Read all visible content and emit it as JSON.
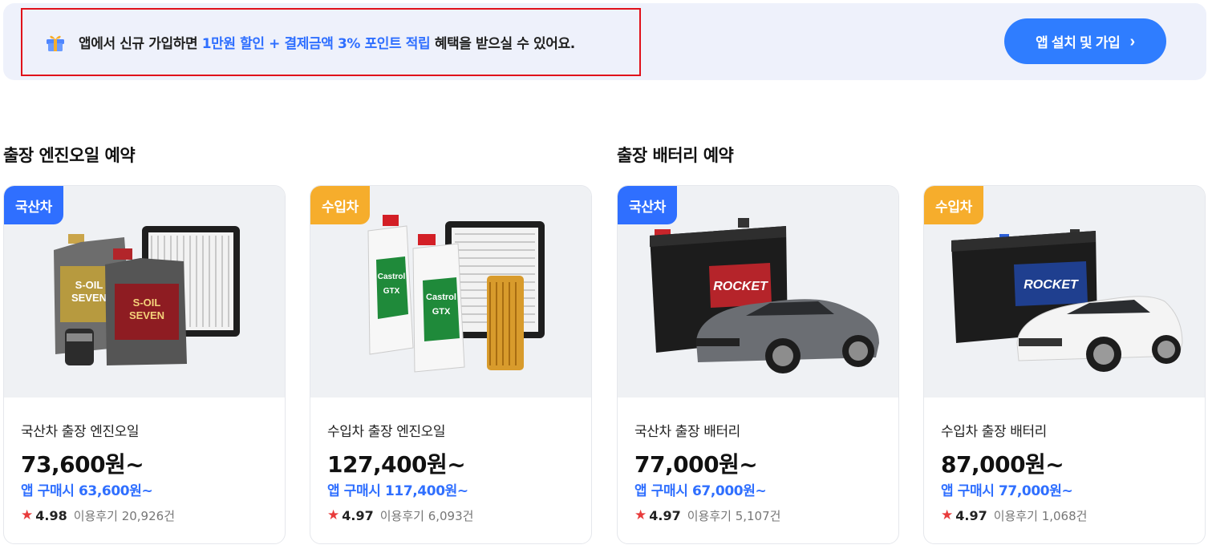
{
  "banner": {
    "icon": "gift-icon",
    "text_before": "앱에서 신규 가입하면 ",
    "text_highlight": "1만원 할인 + 결제금액 3% 포인트 적립",
    "text_after": " 혜택을 받으실 수 있어요.",
    "cta_label": "앱 설치 및 가입",
    "cta_icon": "chevron-right-icon",
    "highlight_color": "#2f6fff",
    "cta_color": "#2f7dff"
  },
  "sections": {
    "oil_title": "출장 엔진오일 예약",
    "battery_title": "출장 배터리 예약"
  },
  "products": [
    {
      "badge": "국산차",
      "badge_color": "#2f6fff",
      "name": "국산차 출장 엔진오일",
      "price": "73,600원~",
      "app_price": "앱 구매시 63,600원~",
      "rating": "4.98",
      "reviews": "이용후기 20,926건",
      "image": "engine-oil-domestic"
    },
    {
      "badge": "수입차",
      "badge_color": "#f6ad2c",
      "name": "수입차 출장 엔진오일",
      "price": "127,400원~",
      "app_price": "앱 구매시 117,400원~",
      "rating": "4.97",
      "reviews": "이용후기 6,093건",
      "image": "engine-oil-import"
    },
    {
      "badge": "국산차",
      "badge_color": "#2f6fff",
      "name": "국산차 출장 배터리",
      "price": "77,000원~",
      "app_price": "앱 구매시 67,000원~",
      "rating": "4.97",
      "reviews": "이용후기 5,107건",
      "image": "battery-domestic"
    },
    {
      "badge": "수입차",
      "badge_color": "#f6ad2c",
      "name": "수입차 출장 배터리",
      "price": "87,000원~",
      "app_price": "앱 구매시 77,000원~",
      "rating": "4.97",
      "reviews": "이용후기 1,068건",
      "image": "battery-import"
    }
  ],
  "image_text": {
    "oil_brand_1": "S-OIL",
    "oil_brand_2": "SEVEN",
    "oil_brand_3": "Castrol",
    "oil_brand_4": "GTX",
    "battery_brand": "ROCKET"
  }
}
